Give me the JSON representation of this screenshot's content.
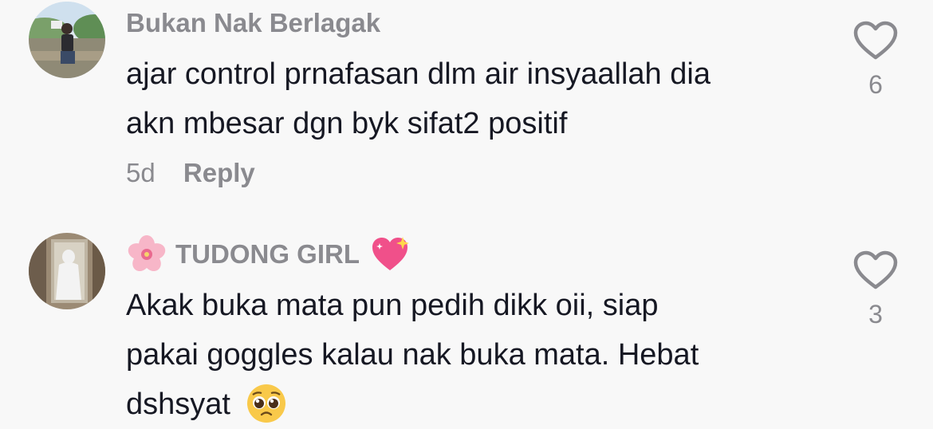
{
  "comments": [
    {
      "username": "Bukan Nak Berlagak",
      "text_line1": "ajar control prnafasan dlm air insyaallah dia",
      "text_line2": "akn mbesar dgn byk sifat2 positif",
      "time": "5d",
      "reply_label": "Reply",
      "likes": "6"
    },
    {
      "username": "TUDONG GIRL",
      "text_line1": "Akak buka mata pun pedih dikk oii, siap",
      "text_line2": "pakai goggles kalau nak buka mata. Hebat",
      "text_line3": "dshsyat",
      "likes": "3"
    }
  ],
  "icons": {
    "like": "heart-outline-icon",
    "username_prefix": "cherry-blossom-emoji",
    "username_suffix": "sparkling-heart-emoji",
    "text_suffix": "pleading-face-emoji"
  },
  "colors": {
    "background": "#f8f8f8",
    "text": "#161823",
    "secondary": "#8a8a8f"
  }
}
